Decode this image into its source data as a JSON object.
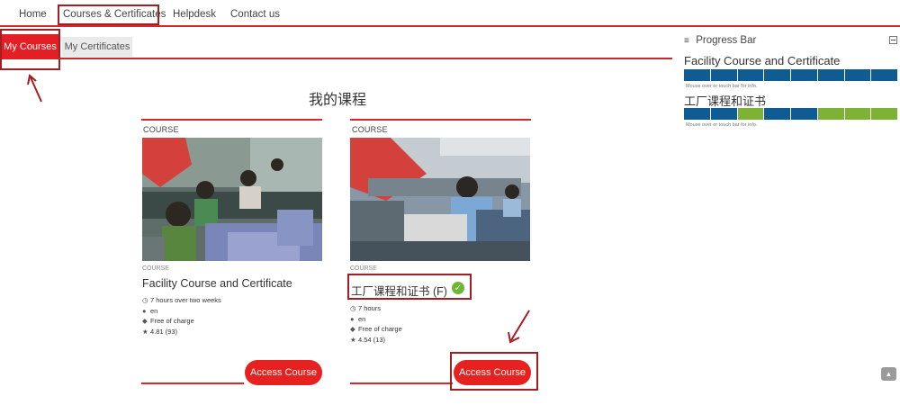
{
  "nav": {
    "items": [
      "Home",
      "Courses & Certificates",
      "Helpdesk",
      "Contact us"
    ]
  },
  "tabs": {
    "my_courses": "My Courses",
    "my_certificates": "My Certificates"
  },
  "page_title": "我的课程",
  "courses": [
    {
      "header_label": "COURSE",
      "small_label": "COURSE",
      "title": "Facility Course and Certificate",
      "duration": "7 hours over two weeks",
      "language": "en",
      "price": "Free of charge",
      "rating": "4.81 (93)",
      "button": "Access Course",
      "completed": false
    },
    {
      "header_label": "COURSE",
      "small_label": "COURSE",
      "title": "工厂课程和证书 (F)",
      "duration": "7 hours",
      "language": "en",
      "price": "Free of charge",
      "rating": "4.54 (13)",
      "button": "Access Course",
      "completed": true
    }
  ],
  "progress": {
    "header": "Progress Bar",
    "hint": "Mouse over or touch bar for info.",
    "courses": [
      {
        "name": "Facility Course and Certificate",
        "segments": [
          "blue",
          "blue",
          "blue",
          "blue",
          "blue",
          "blue",
          "blue",
          "blue"
        ]
      },
      {
        "name": "工厂课程和证书",
        "segments": [
          "blue",
          "blue",
          "green",
          "blue",
          "blue",
          "green",
          "green",
          "green"
        ]
      }
    ]
  },
  "colors": {
    "accent": "#e31e24",
    "progress_blue": "#0f5b94",
    "progress_green": "#7db234",
    "check_green": "#6cb830"
  },
  "icons": {
    "duration": "clock-icon",
    "language": "globe-icon",
    "price": "tag-icon",
    "rating": "star-icon",
    "completed": "check-circle-icon",
    "menu": "hamburger-icon",
    "collapse": "minimize-icon",
    "scroll": "chevron-up-icon"
  }
}
